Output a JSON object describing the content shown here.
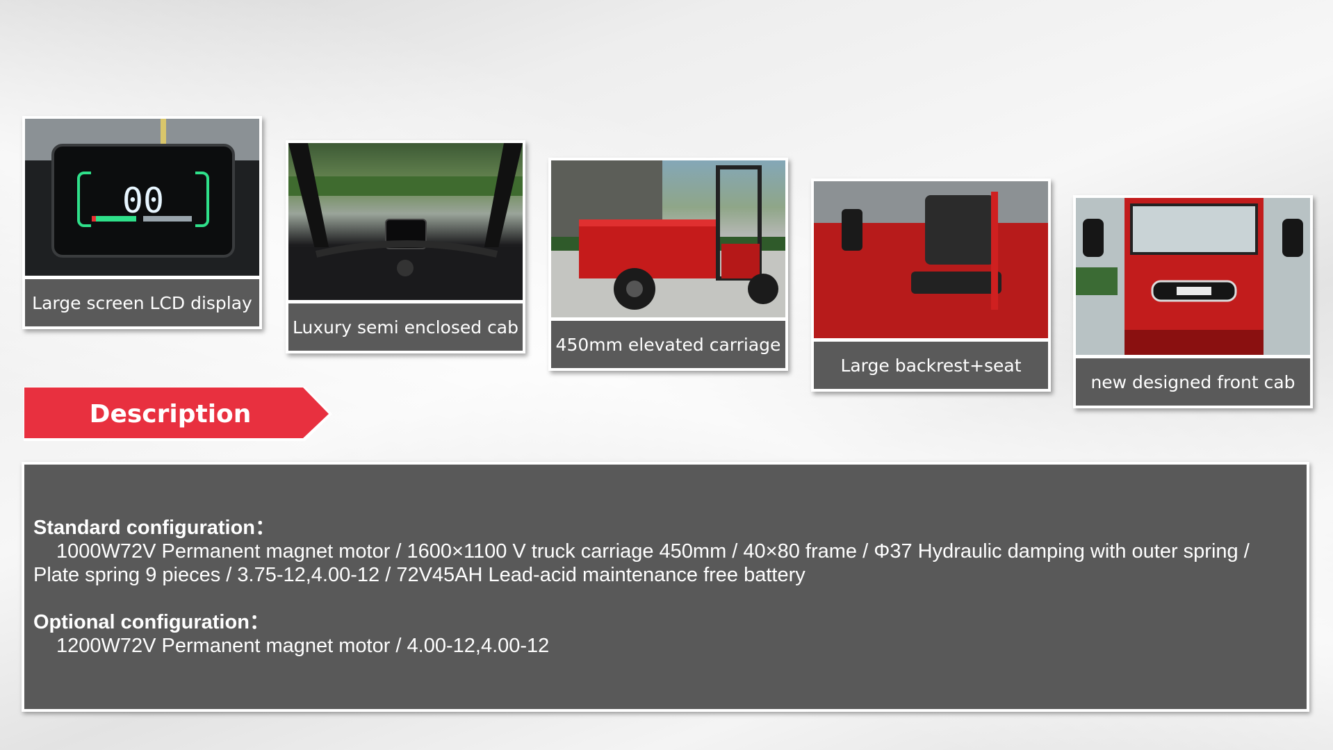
{
  "features": [
    {
      "caption": "Large screen LCD display",
      "photo": "lcd-display-photo"
    },
    {
      "caption": "Luxury semi enclosed cab",
      "photo": "cab-interior-photo"
    },
    {
      "caption": "450mm elevated carriage",
      "photo": "carriage-side-photo"
    },
    {
      "caption": "Large backrest+seat",
      "photo": "seat-photo"
    },
    {
      "caption": "new designed front cab",
      "photo": "front-cab-photo"
    }
  ],
  "description": {
    "heading": "Description",
    "standard_title": "Standard configuration：",
    "standard_text": "1000W72V Permanent magnet motor / 1600×1100 V truck carriage 450mm / 40×80 frame / Φ37 Hydraulic damping with outer spring / Plate spring 9 pieces / 3.75-12,4.00-12 / 72V45AH Lead-acid maintenance free battery",
    "optional_title": "Optional configuration：",
    "optional_text": "1200W72V Permanent magnet motor / 4.00-12,4.00-12"
  },
  "lcd_readout": "00",
  "colors": {
    "accent": "#e8303f",
    "panel": "#595959",
    "caption_bg": "#5a5a5a"
  }
}
